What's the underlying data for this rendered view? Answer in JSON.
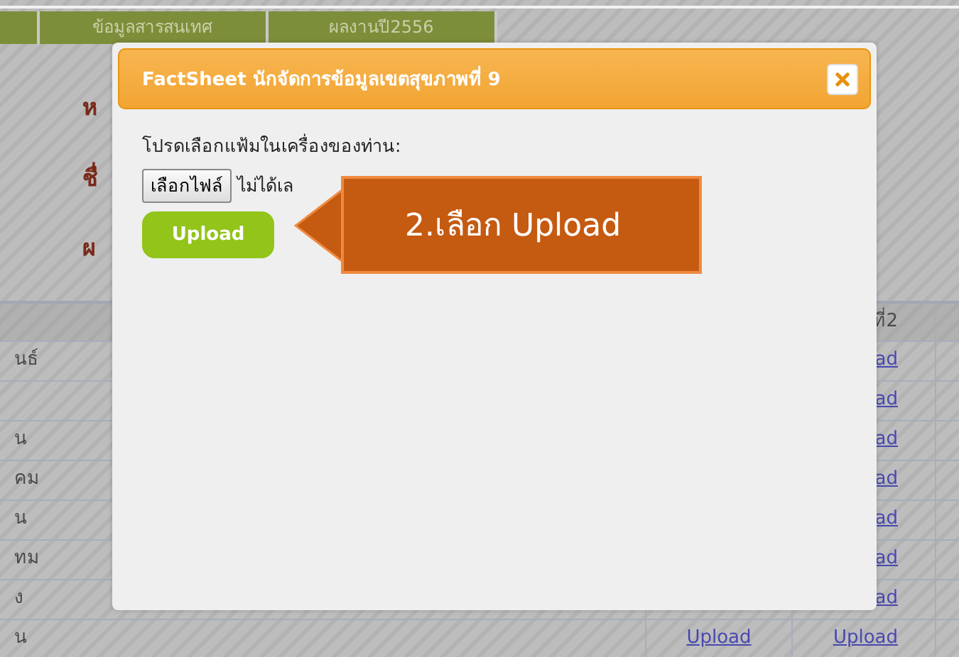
{
  "tabs": [
    {
      "selected": false
    },
    {
      "label": "ข้อมูลสารสนเทศ",
      "selected": false
    },
    {
      "label": "ผลงานปี2556",
      "selected": false
    }
  ],
  "labels": [
    "ห",
    "ชื่",
    "ผ"
  ],
  "table": {
    "column_3": "ที่2",
    "rows": [
      {
        "column_1": "นธ์",
        "column_3": "ad"
      },
      {
        "column_3": "ad"
      },
      {
        "column_1": "น",
        "column_3": "ad"
      },
      {
        "column_1": "คม",
        "column_3": "ad"
      },
      {
        "column_1": "น",
        "column_3": "ad"
      },
      {
        "column_1": "ทม",
        "column_3": "ad"
      },
      {
        "column_1": "ง",
        "column_3": "ad"
      },
      {
        "column_1": "น",
        "column_2": "Upload",
        "column_3": "Upload"
      }
    ]
  },
  "dialog": {
    "title": "FactSheet นักจัดการข้อมูลเขตสุขภาพที่ 9",
    "prompt": "โปรดเลือกแฟ้มในเครื่องของท่าน:",
    "file_button": "เลือกไฟล์",
    "file_status": "ไม่ได้เล",
    "upload_button": "Upload"
  },
  "callout": {
    "text": "2.เลือก Upload"
  }
}
